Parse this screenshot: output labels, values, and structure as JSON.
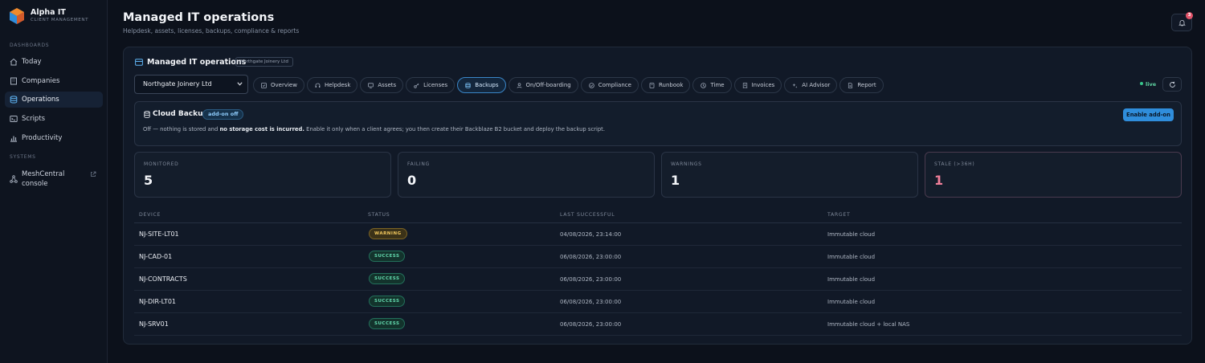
{
  "brand": {
    "name": "Alpha IT",
    "subtitle": "CLIENT MANAGEMENT"
  },
  "sidebar": {
    "sections": [
      {
        "label": "DASHBOARDS"
      },
      {
        "label": "SYSTEMS"
      }
    ],
    "items": [
      {
        "label": "Today",
        "icon": "home-icon"
      },
      {
        "label": "Companies",
        "icon": "building-icon"
      },
      {
        "label": "Operations",
        "icon": "database-icon",
        "active": true
      },
      {
        "label": "Scripts",
        "icon": "terminal-icon"
      },
      {
        "label": "Productivity",
        "icon": "bar-chart-icon"
      }
    ],
    "systems": [
      {
        "label_line1": "MeshCentral",
        "label_line2": "console",
        "icon": "network-icon"
      }
    ]
  },
  "header": {
    "title": "Managed IT operations",
    "subtitle": "Helpdesk, assets, licenses, backups, compliance & reports",
    "notification_count": "3"
  },
  "panel": {
    "title": "Managed IT operations",
    "client_tag": "Northgate Joinery Ltd",
    "client_select": "Northgate Joinery Ltd",
    "tabs": [
      {
        "label": "Overview",
        "icon": "overview-icon"
      },
      {
        "label": "Helpdesk",
        "icon": "headset-icon"
      },
      {
        "label": "Assets",
        "icon": "monitor-icon"
      },
      {
        "label": "Licenses",
        "icon": "key-icon"
      },
      {
        "label": "Backups",
        "icon": "database-icon",
        "active": true
      },
      {
        "label": "On/Off-boarding",
        "icon": "user-icon"
      },
      {
        "label": "Compliance",
        "icon": "check-circle-icon"
      },
      {
        "label": "Runbook",
        "icon": "book-icon"
      },
      {
        "label": "Time",
        "icon": "clock-icon"
      },
      {
        "label": "Invoices",
        "icon": "receipt-icon"
      },
      {
        "label": "AI Advisor",
        "icon": "sparkles-icon"
      },
      {
        "label": "Report",
        "icon": "file-icon"
      }
    ],
    "live_label": "live"
  },
  "cloud_backup": {
    "title": "Cloud Backup",
    "addon_tag": "add-on off",
    "desc_pre": "Off — nothing is stored and ",
    "desc_bold": "no storage cost is incurred.",
    "desc_post": " Enable it only when a client agrees; you then create their Backblaze B2 bucket and deploy the backup script.",
    "enable_button": "Enable add-on"
  },
  "stats": [
    {
      "label": "MONITORED",
      "value": "5"
    },
    {
      "label": "FAILING",
      "value": "0"
    },
    {
      "label": "WARNINGS",
      "value": "1"
    },
    {
      "label": "STALE (>36H)",
      "value": "1"
    }
  ],
  "table": {
    "headers": [
      "DEVICE",
      "STATUS",
      "LAST SUCCESSFUL",
      "TARGET"
    ],
    "rows": [
      {
        "device": "NJ-SITE-LT01",
        "status": "WARNING",
        "last": "04/08/2026, 23:14:00",
        "target": "Immutable cloud"
      },
      {
        "device": "NJ-CAD-01",
        "status": "SUCCESS",
        "last": "06/08/2026, 23:00:00",
        "target": "Immutable cloud"
      },
      {
        "device": "NJ-CONTRACTS",
        "status": "SUCCESS",
        "last": "06/08/2026, 23:00:00",
        "target": "Immutable cloud"
      },
      {
        "device": "NJ-DIR-LT01",
        "status": "SUCCESS",
        "last": "06/08/2026, 23:00:00",
        "target": "Immutable cloud"
      },
      {
        "device": "NJ-SRV01",
        "status": "SUCCESS",
        "last": "06/08/2026, 23:00:00",
        "target": "Immutable cloud + local NAS"
      }
    ]
  },
  "colors": {
    "background": "#0c111b",
    "accent": "#2f8ddb",
    "warning": "#f3c95e",
    "success": "#62d8ad",
    "stale": "#f07f9a"
  }
}
